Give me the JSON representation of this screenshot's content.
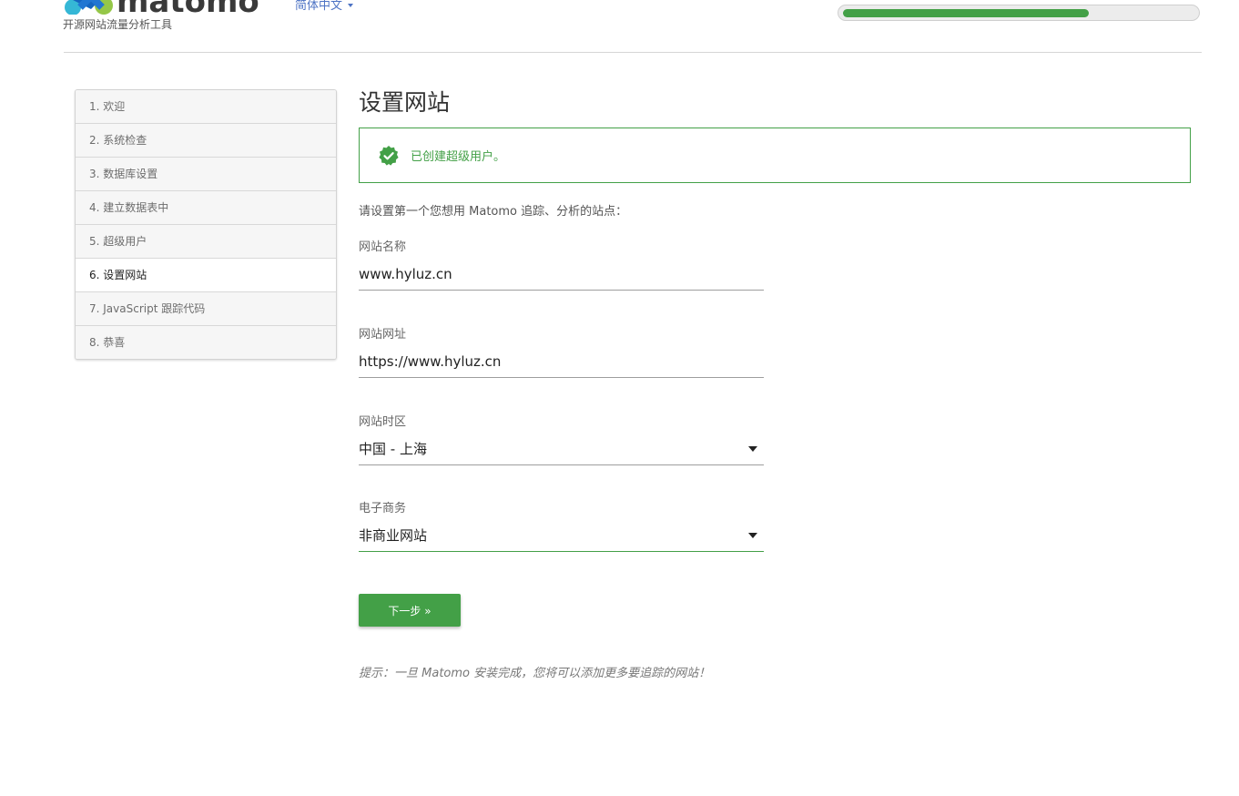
{
  "header": {
    "logo_text": "matomo",
    "subtitle": "开源网站流量分析工具",
    "language": "简体中文",
    "progress": 0.7
  },
  "steps": [
    {
      "label": "1. 欢迎"
    },
    {
      "label": "2. 系统检查"
    },
    {
      "label": "3. 数据库设置"
    },
    {
      "label": "4. 建立数据表中"
    },
    {
      "label": "5. 超级用户"
    },
    {
      "label": "6. 设置网站",
      "active": true
    },
    {
      "label": "7. JavaScript 跟踪代码"
    },
    {
      "label": "8. 恭喜"
    }
  ],
  "main": {
    "title": "设置网站",
    "alert": "已创建超级用户。",
    "intro": "请设置第一个您想用 Matomo 追踪、分析的站点：",
    "fields": {
      "site_name": {
        "label": "网站名称",
        "value": "www.hyluz.cn"
      },
      "site_url": {
        "label": "网站网址",
        "value": "https://www.hyluz.cn"
      },
      "timezone": {
        "label": "网站时区",
        "value": "中国 - 上海"
      },
      "ecommerce": {
        "label": "电子商务",
        "value": "非商业网站"
      }
    },
    "next_button": "下一步 »",
    "hint": "提示：一旦 Matomo 安装完成，您将可以添加更多要追踪的网站！"
  },
  "colors": {
    "accent": "#43a047",
    "link": "#4d73c4"
  },
  "icons": {
    "alert": "check-badge-icon",
    "language": "caret-down-icon",
    "select": "dropdown-triangle-icon"
  }
}
